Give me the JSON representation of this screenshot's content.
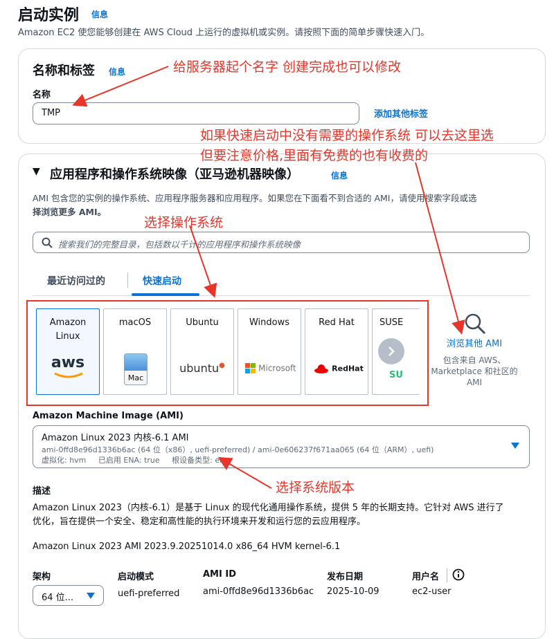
{
  "header": {
    "title": "启动实例",
    "info": "信息",
    "subtitle": "Amazon EC2 使您能够创建在 AWS Cloud 上运行的虚拟机或实例。请按照下面的简单步骤快速入门。"
  },
  "name_section": {
    "title": "名称和标签",
    "info": "信息",
    "name_label": "名称",
    "name_value": "TMP",
    "add_tags": "添加其他标签"
  },
  "ami_section": {
    "title": "应用程序和操作系统映像（亚马逊机器映像）",
    "info": "信息",
    "desc_line1": "AMI 包含您的实例的操作系统、应用程序服务器和应用程序。如果您在下面看不到合适的 AMI，请使用搜索字段或选",
    "desc_line2": "择浏览更多 AMI。",
    "search_placeholder": "搜索我们的完整目录，包括数以千计的应用程序和操作系统映像",
    "tabs": [
      "最近访问过的",
      "快速启动"
    ],
    "tiles": [
      {
        "name": "Amazon Linux",
        "logo": "aws"
      },
      {
        "name": "macOS",
        "logo": "Mac"
      },
      {
        "name": "Ubuntu",
        "logo": "ubuntu"
      },
      {
        "name": "Windows",
        "logo": "Microsoft"
      },
      {
        "name": "Red Hat",
        "logo": "RedHat"
      },
      {
        "name": "SUSE",
        "logo": "SU"
      }
    ],
    "browse_more": "浏览其他 AMI",
    "browse_desc": [
      "包含来自 AWS、",
      "Marketplace 和社区的",
      "AMI"
    ],
    "ami_label": "Amazon Machine Image (AMI)",
    "ami_name": "Amazon Linux 2023 内核-6.1 AMI",
    "ami_ids": "ami-0ffd8e96d1336b6ac (64 位（x86）, uefi-preferred) / ami-0e606237f671aa065 (64 位（ARM）, uefi)",
    "ami_meta": "虚拟化: hvm     已启用 ENA: true     根设备类型: ebs",
    "desc_label": "描述",
    "desc_text1": "Amazon Linux 2023（内核-6.1）是基于 Linux 的现代化通用操作系统，提供 5 年的长期支持。它针对 AWS 进行了",
    "desc_text2": "优化，旨在提供一个安全、稳定和高性能的执行环境来开发和运行您的云应用程序。",
    "ami_version": "Amazon Linux 2023 AMI 2023.9.20251014.0 x86_64 HVM kernel-6.1",
    "details": {
      "arch_label": "架构",
      "arch_value": "64 位...",
      "boot_label": "启动模式",
      "boot_value": "uefi-preferred",
      "id_label": "AMI ID",
      "id_value": "ami-0ffd8e96d1336b6ac",
      "date_label": "发布日期",
      "date_value": "2025-10-09",
      "user_label": "用户名",
      "user_value": "ec2-user"
    }
  },
  "annotations": {
    "name_tip": "给服务器起个名字 创建完成也可以修改",
    "browse_tip1": "如果快速启动中没有需要的操作系统 可以去这里选",
    "browse_tip2": "但要注意价格,里面有免费的也有收费的",
    "os_tip": "选择操作系统",
    "version_tip": "选择系统版本"
  },
  "colors": {
    "link": "#0972d3",
    "annotation": "#e8352a",
    "aws_orange": "#ff9900",
    "ubuntu": "#e95420",
    "redhat": "#ee0000"
  }
}
